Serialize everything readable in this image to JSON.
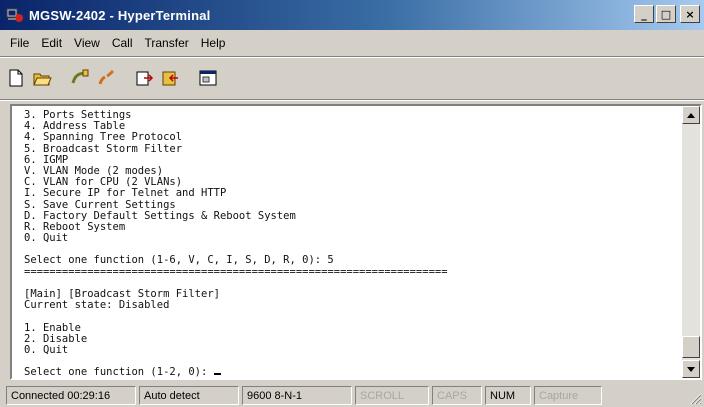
{
  "window": {
    "title": "MGSW-2402 - HyperTerminal",
    "buttons": {
      "minimize": "_",
      "maximize": "□",
      "close": "×"
    }
  },
  "menu": [
    "File",
    "Edit",
    "View",
    "Call",
    "Transfer",
    "Help"
  ],
  "toolbar": {
    "buttons": [
      "new-connection-icon",
      "open-icon",
      "connect-icon",
      "disconnect-icon",
      "send-icon",
      "receive-icon",
      "properties-icon"
    ]
  },
  "terminal": {
    "lines": [
      "3. Ports Settings",
      "4. Address Table",
      "4. Spanning Tree Protocol",
      "5. Broadcast Storm Filter",
      "6. IGMP",
      "V. VLAN Mode (2 modes)",
      "C. VLAN for CPU (2 VLANs)",
      "I. Secure IP for Telnet and HTTP",
      "S. Save Current Settings",
      "D. Factory Default Settings & Reboot System",
      "R. Reboot System",
      "0. Quit",
      "",
      "Select one function (1-6, V, C, I, S, D, R, 0): 5",
      "===================================================================",
      "",
      "[Main] [Broadcast Storm Filter]",
      "Current state: Disabled",
      "",
      "1. Enable",
      "2. Disable",
      "0. Quit",
      ""
    ],
    "prompt": "Select one function (1-2, 0): "
  },
  "statusbar": {
    "connected": "Connected 00:29:16",
    "detect": "Auto detect",
    "settings": "9600 8-N-1",
    "scroll": "SCROLL",
    "caps": "CAPS",
    "num": "NUM",
    "capture": "Capture"
  }
}
